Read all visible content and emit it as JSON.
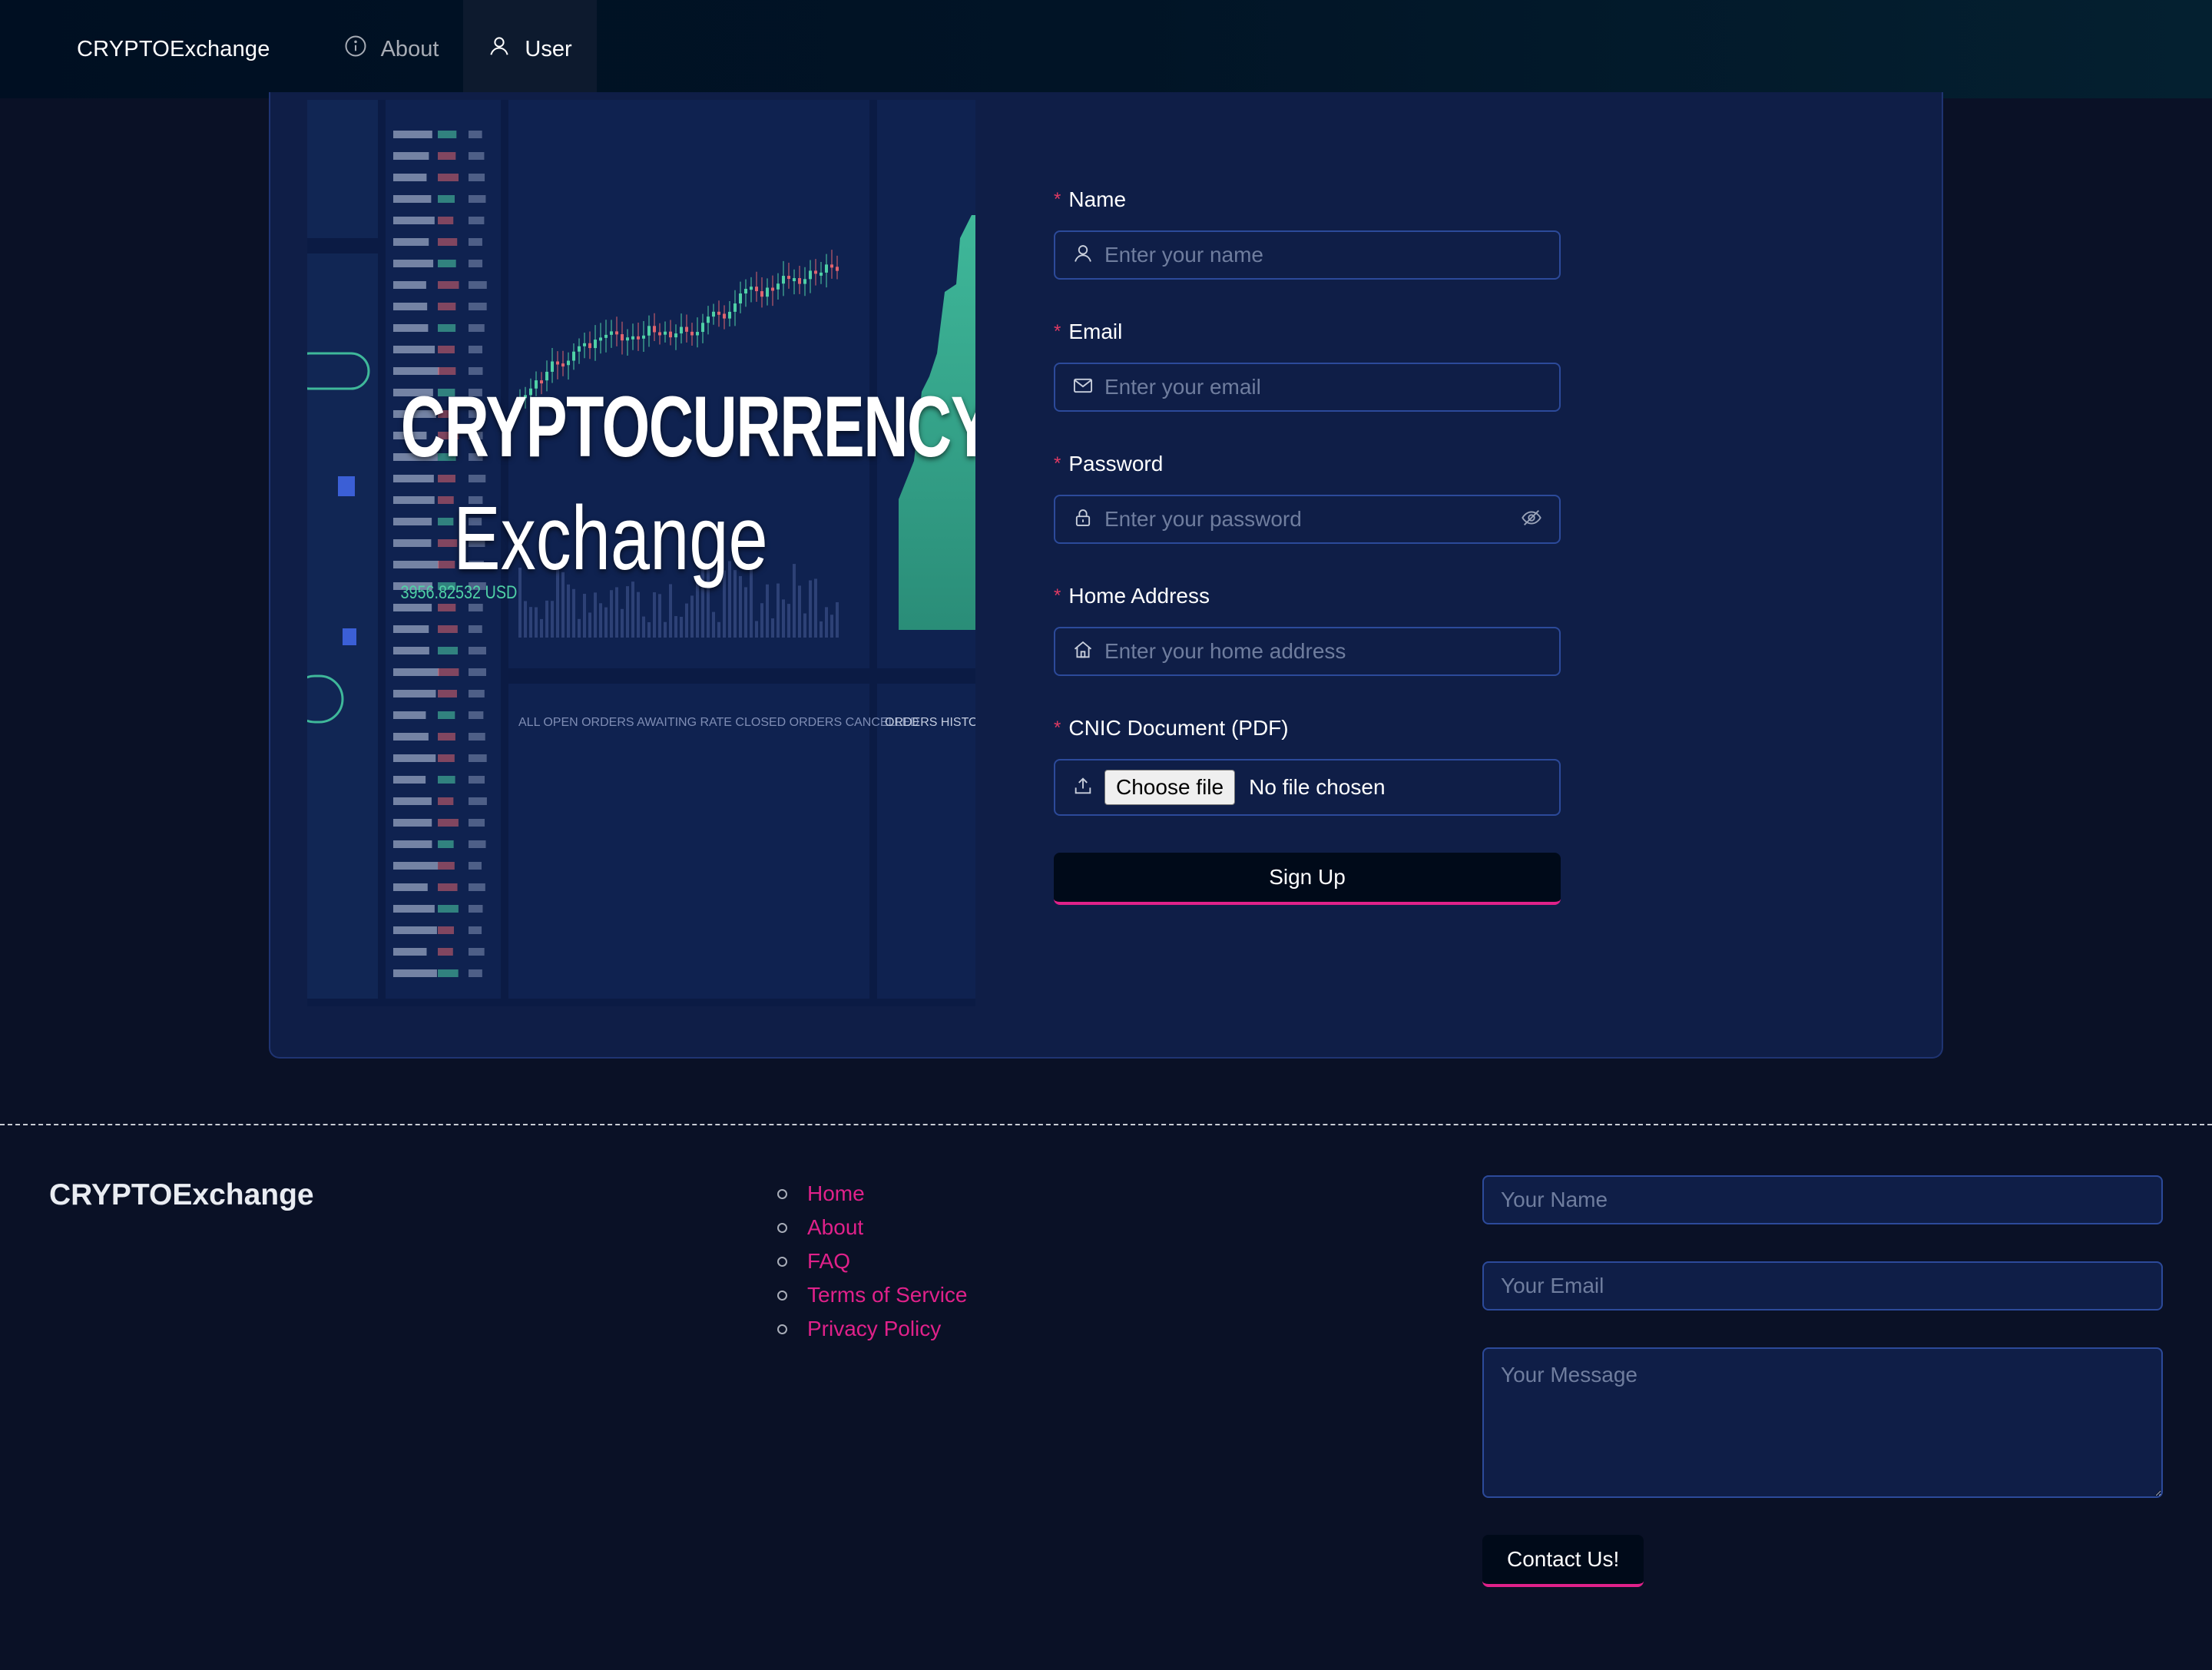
{
  "header": {
    "brand": "CRYPTOExchange",
    "nav": {
      "about": {
        "label": "About",
        "icon": "info-circle-icon"
      },
      "user": {
        "label": "User",
        "icon": "user-icon"
      }
    }
  },
  "hero": {
    "line1": "CRYPTOCURRENCY",
    "line2": "Exchange"
  },
  "form": {
    "name": {
      "label": "Name",
      "placeholder": "Enter your name",
      "icon": "user-icon"
    },
    "email": {
      "label": "Email",
      "placeholder": "Enter your email",
      "icon": "mail-icon"
    },
    "password": {
      "label": "Password",
      "placeholder": "Enter your password",
      "icon": "lock-icon"
    },
    "address": {
      "label": "Home Address",
      "placeholder": "Enter your home address",
      "icon": "home-icon"
    },
    "cnic": {
      "label": "CNIC Document (PDF)",
      "button": "Choose file",
      "status": "No file chosen",
      "icon": "upload-icon"
    },
    "required_mark": "*",
    "submit": "Sign Up"
  },
  "footer": {
    "brand": "CRYPTOExchange",
    "links": [
      "Home",
      "About",
      "FAQ",
      "Terms of Service",
      "Privacy Policy"
    ],
    "contact": {
      "name_placeholder": "Your Name",
      "email_placeholder": "Your Email",
      "message_placeholder": "Your Message",
      "button": "Contact Us!"
    }
  },
  "colors": {
    "accent": "#e0218a",
    "background": "#0a1126",
    "card": "#0f1e47",
    "input_border": "#2c4a9a",
    "required": "#e03a63"
  }
}
